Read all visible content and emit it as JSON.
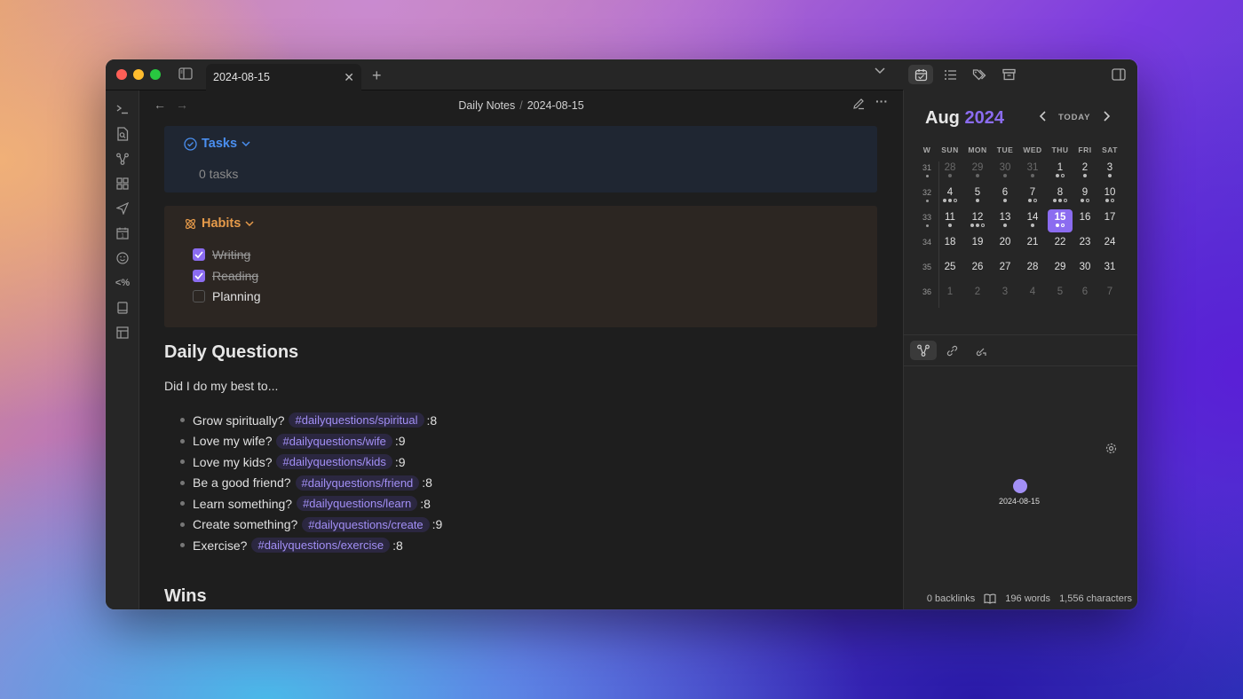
{
  "tab": {
    "title": "2024-08-15"
  },
  "breadcrumb": {
    "folder": "Daily Notes",
    "sep": "/",
    "note": "2024-08-15"
  },
  "tasks": {
    "title": "Tasks",
    "count_text": "0 tasks"
  },
  "habits": {
    "title": "Habits",
    "items": [
      {
        "label": "Writing",
        "checked": true
      },
      {
        "label": "Reading",
        "checked": true
      },
      {
        "label": "Planning",
        "checked": false
      }
    ]
  },
  "questions": {
    "heading": "Daily Questions",
    "intro": "Did I do my best to...",
    "items": [
      {
        "text": "Grow spiritually?",
        "tag": "#dailyquestions/spiritual",
        "score": ":8"
      },
      {
        "text": "Love my wife?",
        "tag": "#dailyquestions/wife",
        "score": ":9"
      },
      {
        "text": "Love my kids?",
        "tag": "#dailyquestions/kids",
        "score": ":9"
      },
      {
        "text": "Be a good friend?",
        "tag": "#dailyquestions/friend",
        "score": ":8"
      },
      {
        "text": "Learn something?",
        "tag": "#dailyquestions/learn",
        "score": ":8"
      },
      {
        "text": "Create something?",
        "tag": "#dailyquestions/create",
        "score": ":9"
      },
      {
        "text": "Exercise?",
        "tag": "#dailyquestions/exercise",
        "score": ":8"
      }
    ]
  },
  "wins": {
    "heading": "Wins"
  },
  "calendar": {
    "month": "Aug",
    "year": "2024",
    "today_label": "TODAY",
    "headers": [
      "W",
      "SUN",
      "MON",
      "TUE",
      "WED",
      "THU",
      "FRI",
      "SAT"
    ],
    "weeks": [
      {
        "wk": "31",
        "days": [
          [
            "28",
            "o",
            1
          ],
          [
            "29",
            "o",
            1
          ],
          [
            "30",
            "o",
            1
          ],
          [
            "31",
            "o",
            1
          ],
          [
            "1",
            "",
            2
          ],
          [
            "2",
            "",
            1
          ],
          [
            "3",
            "",
            1
          ]
        ]
      },
      {
        "wk": "32",
        "days": [
          [
            "4",
            "",
            3
          ],
          [
            "5",
            "",
            1
          ],
          [
            "6",
            "",
            1
          ],
          [
            "7",
            "",
            2
          ],
          [
            "8",
            "",
            3
          ],
          [
            "9",
            "",
            2
          ],
          [
            "10",
            "",
            2
          ]
        ]
      },
      {
        "wk": "33",
        "days": [
          [
            "11",
            "",
            1
          ],
          [
            "12",
            "",
            3
          ],
          [
            "13",
            "",
            1
          ],
          [
            "14",
            "",
            1
          ],
          [
            "15",
            "t",
            2
          ],
          [
            "16",
            "",
            0
          ],
          [
            "17",
            "",
            0
          ]
        ]
      },
      {
        "wk": "34",
        "days": [
          [
            "18",
            "",
            0
          ],
          [
            "19",
            "",
            0
          ],
          [
            "20",
            "",
            0
          ],
          [
            "21",
            "",
            0
          ],
          [
            "22",
            "",
            0
          ],
          [
            "23",
            "",
            0
          ],
          [
            "24",
            "",
            0
          ]
        ]
      },
      {
        "wk": "35",
        "days": [
          [
            "25",
            "",
            0
          ],
          [
            "26",
            "",
            0
          ],
          [
            "27",
            "",
            0
          ],
          [
            "28",
            "",
            0
          ],
          [
            "29",
            "",
            0
          ],
          [
            "30",
            "",
            0
          ],
          [
            "31",
            "",
            0
          ]
        ]
      },
      {
        "wk": "36",
        "days": [
          [
            "1",
            "o",
            0
          ],
          [
            "2",
            "o",
            0
          ],
          [
            "3",
            "o",
            0
          ],
          [
            "4",
            "o",
            0
          ],
          [
            "5",
            "o",
            0
          ],
          [
            "6",
            "o",
            0
          ],
          [
            "7",
            "o",
            0
          ]
        ]
      }
    ]
  },
  "graph": {
    "node_label": "2024-08-15"
  },
  "status_bar": {
    "backlinks": "0 backlinks",
    "words": "196 words",
    "characters": "1,556 characters"
  },
  "colors": {
    "accent": "#8b6cf0",
    "tasks": "#4a8ff0",
    "habits": "#e59a4a"
  }
}
